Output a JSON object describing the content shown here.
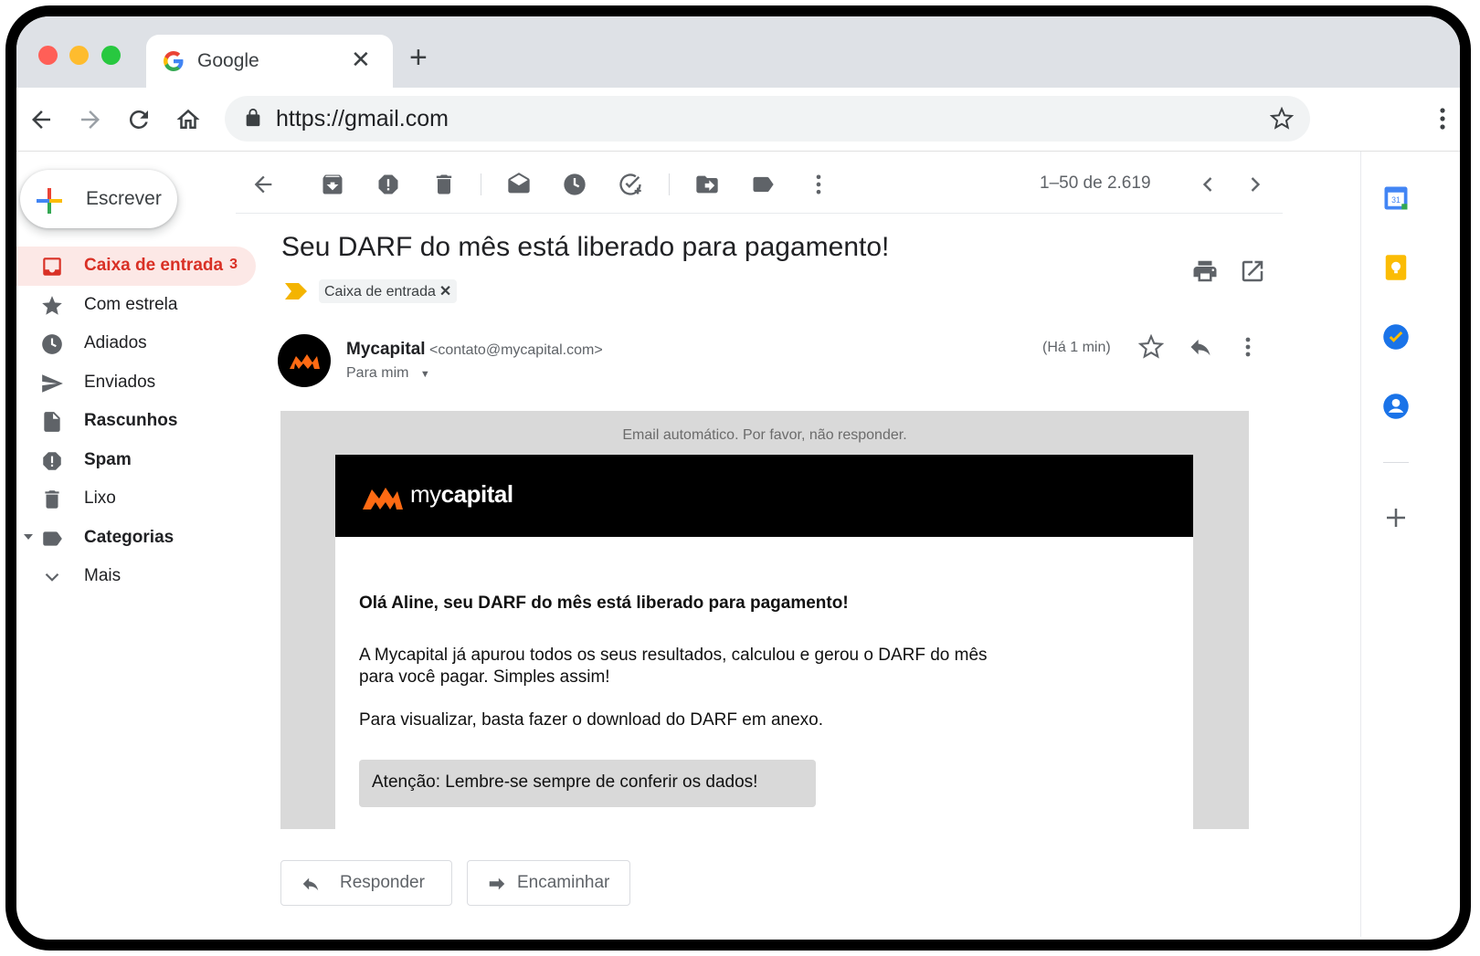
{
  "browser": {
    "tab_title": "Google",
    "url": "https://gmail.com"
  },
  "sidebar": {
    "compose_label": "Escrever",
    "items": [
      {
        "label": "Caixa de entrada",
        "count": "3",
        "icon": "inbox-icon",
        "active": true
      },
      {
        "label": "Com estrela",
        "icon": "star-icon"
      },
      {
        "label": "Adiados",
        "icon": "clock-icon"
      },
      {
        "label": "Enviados",
        "icon": "send-icon"
      },
      {
        "label": "Rascunhos",
        "icon": "draft-icon",
        "bold": true
      },
      {
        "label": "Spam",
        "icon": "spam-icon",
        "bold": true
      },
      {
        "label": "Lixo",
        "icon": "trash-icon"
      },
      {
        "label": "Categorias",
        "icon": "label-icon",
        "bold": true
      },
      {
        "label": "Mais",
        "icon": "chevron-down-icon"
      }
    ]
  },
  "toolbar": {
    "pager": "1–50 de 2.619"
  },
  "message": {
    "subject": "Seu DARF do mês está liberado para pagamento!",
    "label_chip": "Caixa de entrada",
    "sender_name": "Mycapital",
    "sender_email": "<contato@mycapital.com>",
    "to": "Para mim",
    "time": "(Há 1 min)"
  },
  "email": {
    "auto_notice": "Email automático. Por favor, não responder.",
    "brand_light": "my",
    "brand_bold": "capital",
    "greeting": "Olá Aline, seu DARF do mês está liberado para pagamento!",
    "paragraph1": "A Mycapital já apurou todos os seus resultados, calculou e gerou o DARF do mês para você pagar. Simples assim!",
    "paragraph2": "Para visualizar, basta fazer o download do DARF em anexo.",
    "attention": "Atenção: Lembre-se sempre de conferir os dados!"
  },
  "actions": {
    "reply": "Responder",
    "forward": "Encaminhar"
  },
  "colors": {
    "accent_red": "#d93025",
    "brand_orange": "#ff6a13",
    "chip_marker": "#f4b400"
  }
}
